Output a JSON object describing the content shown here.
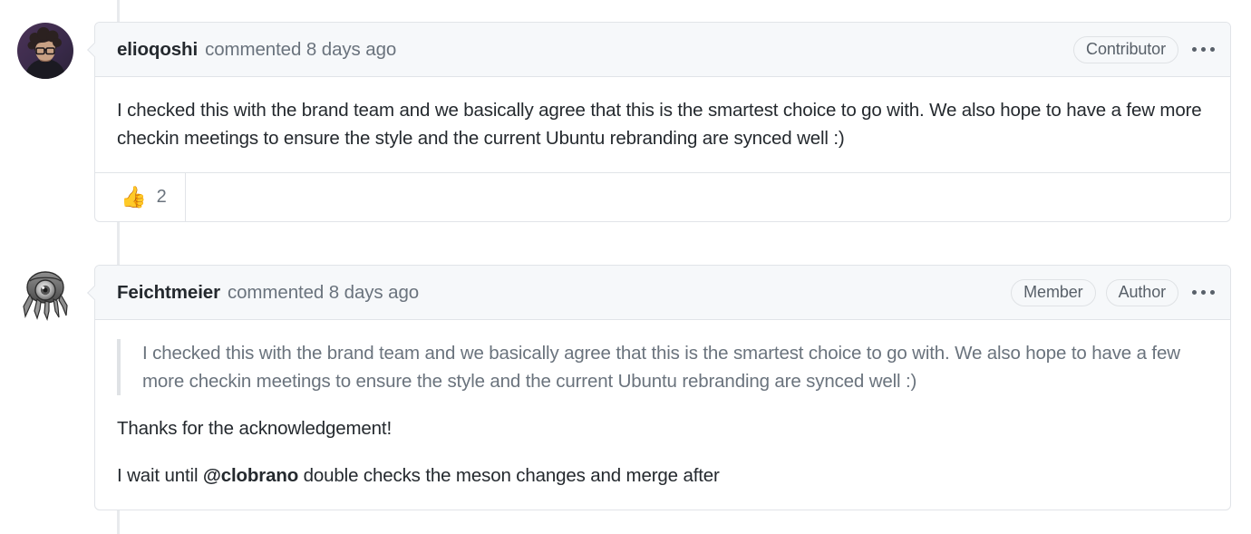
{
  "theme": {
    "page_bg": "#ffffff",
    "header_bg": "#f6f8fa",
    "border": "#e1e4e8",
    "rail": "#e8eaed",
    "text": "#24292e",
    "muted": "#6a737d",
    "badge_text": "#586069"
  },
  "comments": [
    {
      "author": "elioqoshi",
      "meta": "commented 8 days ago",
      "badges": [
        "Contributor"
      ],
      "kebab_label": "•••",
      "body_paragraph": "I checked this with the brand team and we basically agree that this is the smartest choice to go with. We also hope to have a few more checkin meetings to ensure the style and the current Ubuntu rebranding are synced well :)",
      "reactions": [
        {
          "emoji": "👍",
          "emoji_name": "thumbs-up-emoji",
          "count": "2"
        }
      ],
      "avatar_name": "avatar-elioqoshi"
    },
    {
      "author": "Feichtmeier",
      "meta": "commented 8 days ago",
      "badges": [
        "Member",
        "Author"
      ],
      "kebab_label": "•••",
      "quote": "I checked this with the brand team and we basically agree that this is the smartest choice to go with. We also hope to have a few more checkin meetings to ensure the style and the current Ubuntu rebranding are synced well :)",
      "paragraph_1": "Thanks for the acknowledgement!",
      "paragraph_2_before": "I wait until ",
      "paragraph_2_mention": "@clobrano",
      "paragraph_2_after": " double checks the meson changes and merge after",
      "avatar_name": "avatar-feichtmeier"
    }
  ]
}
